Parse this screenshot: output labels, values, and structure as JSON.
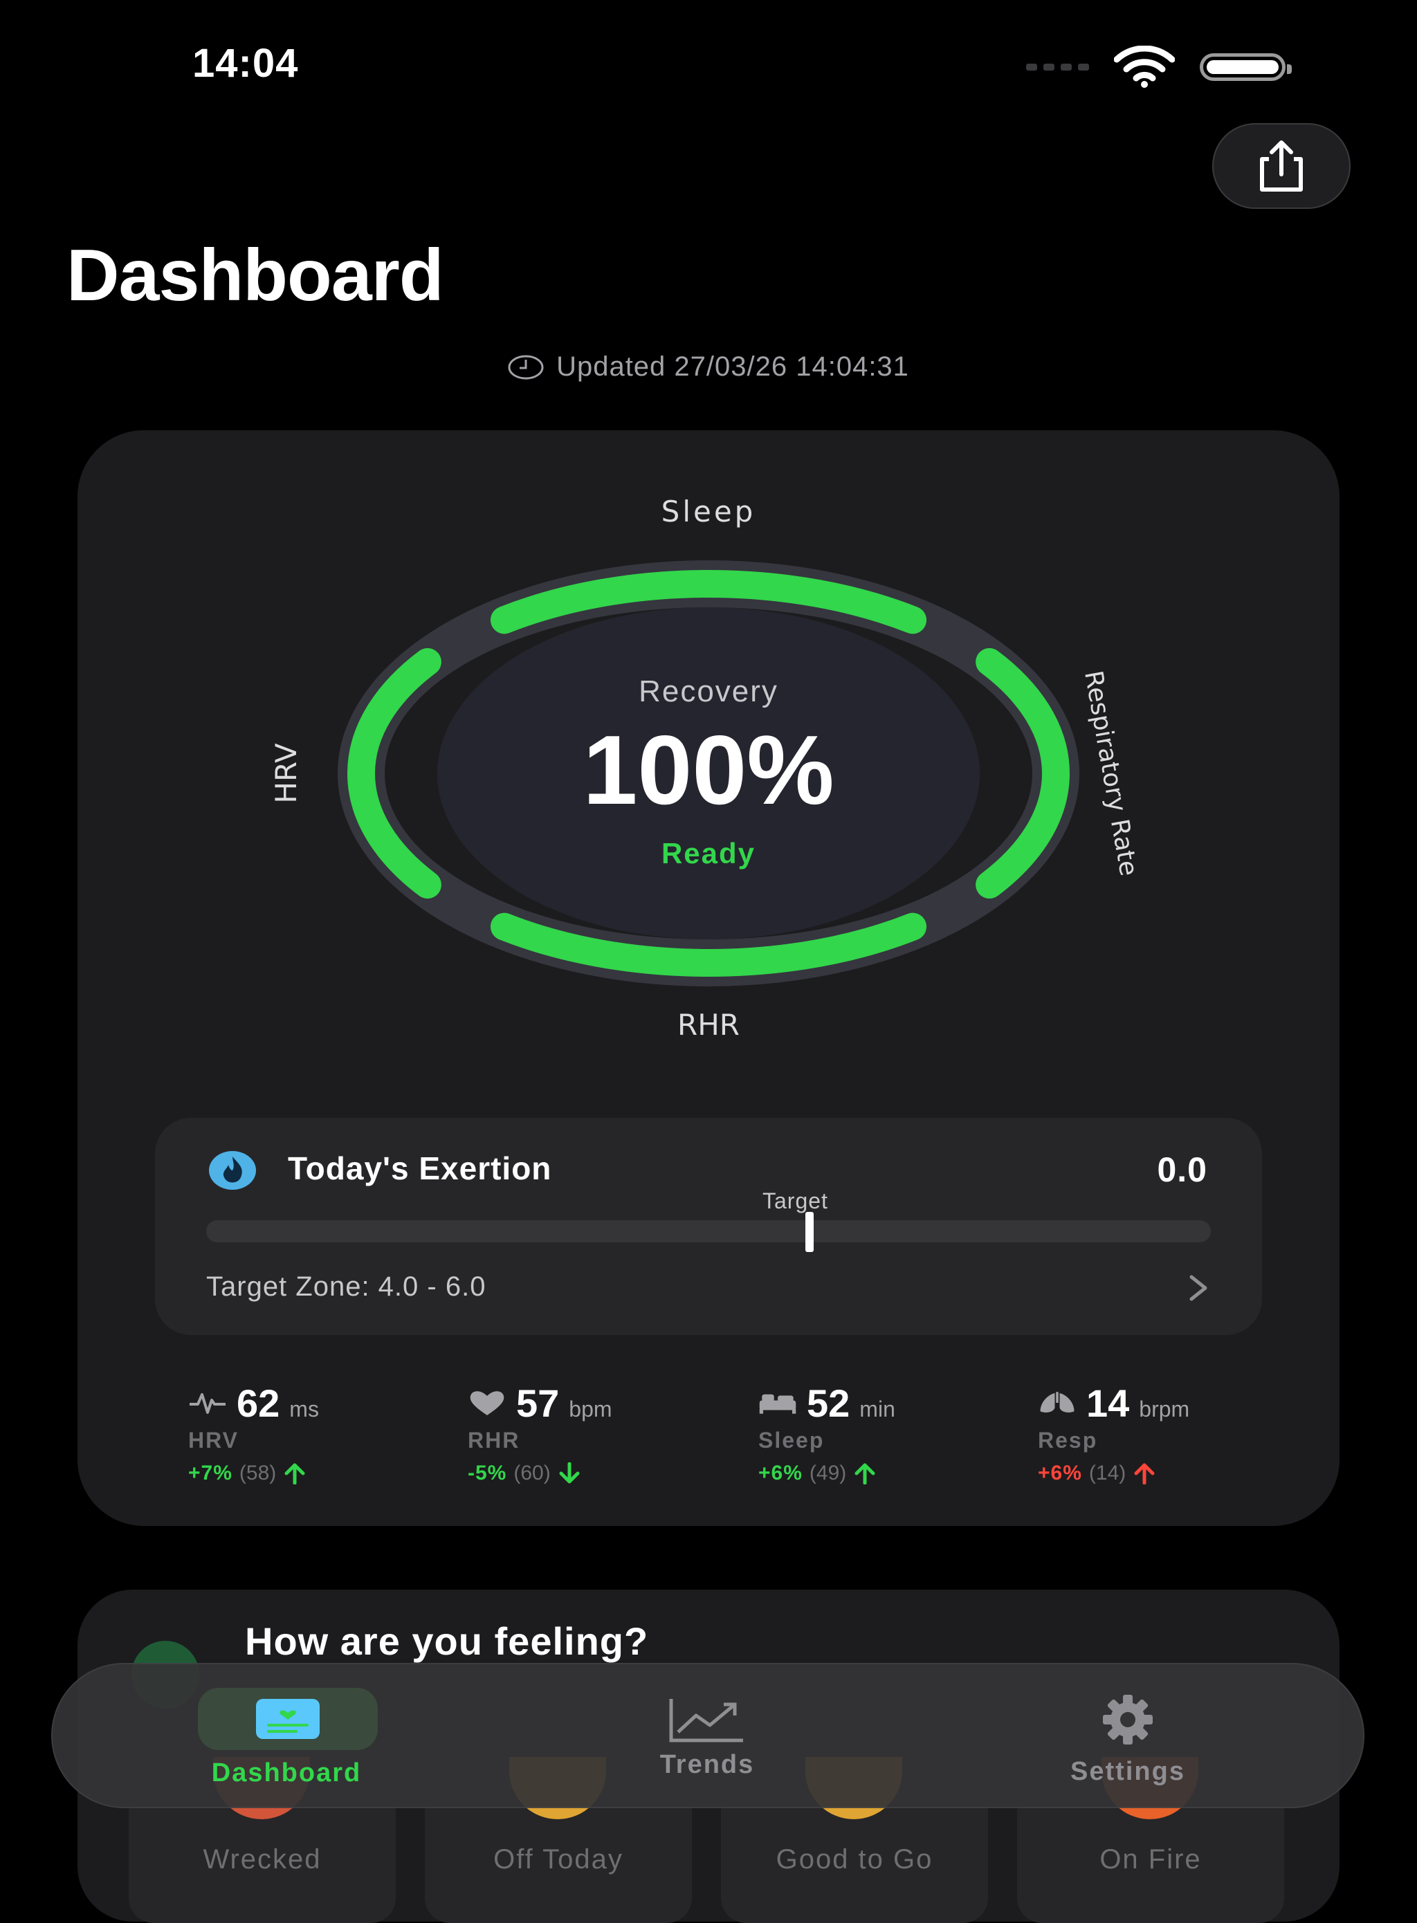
{
  "status_bar": {
    "time": "14:04",
    "icons": [
      "cellular-dots-icon",
      "wifi-icon",
      "battery-icon"
    ]
  },
  "header": {
    "share_icon": "share-icon",
    "title": "Dashboard",
    "updated_text": "Updated 27/03/26 14:04:31",
    "clock_icon": "clock-icon"
  },
  "recovery": {
    "label": "Recovery",
    "value": "100%",
    "status": "Ready",
    "status_color": "#32d74b",
    "ring_labels": {
      "top": "Sleep",
      "left": "HRV",
      "right": "Respiratory Rate",
      "bottom": "RHR"
    },
    "segments": [
      {
        "name": "Sleep",
        "fraction": 1.0
      },
      {
        "name": "Respiratory Rate",
        "fraction": 1.0
      },
      {
        "name": "RHR",
        "fraction": 1.0
      },
      {
        "name": "HRV",
        "fraction": 1.0
      }
    ],
    "ring_color": "#32d74b"
  },
  "exertion": {
    "title": "Today's Exertion",
    "value": "0.0",
    "target_label": "Target",
    "target_zone": "Target Zone: 4.0 - 6.0",
    "icon": "flame-icon"
  },
  "metrics": [
    {
      "icon": "waveform-icon",
      "value": "62",
      "unit": "ms",
      "name": "HRV",
      "delta": "+7%",
      "baseline": "(58)",
      "direction": "up",
      "color": "#32d74b"
    },
    {
      "icon": "heart-icon",
      "value": "57",
      "unit": "bpm",
      "name": "RHR",
      "delta": "-5%",
      "baseline": "(60)",
      "direction": "down",
      "color": "#32d74b"
    },
    {
      "icon": "bed-icon",
      "value": "52",
      "unit": "min",
      "name": "Sleep",
      "delta": "+6%",
      "baseline": "(49)",
      "direction": "up",
      "color": "#32d74b"
    },
    {
      "icon": "lungs-icon",
      "value": "14",
      "unit": "brpm",
      "name": "Resp",
      "delta": "+6%",
      "baseline": "(14)",
      "direction": "up",
      "color": "#ff453a"
    }
  ],
  "feeling": {
    "title": "How are you feeling?",
    "options": [
      "Wrecked",
      "Off Today",
      "Good to Go",
      "On Fire"
    ]
  },
  "tabs": [
    {
      "label": "Dashboard",
      "icon": "dashboard-icon",
      "active": true
    },
    {
      "label": "Trends",
      "icon": "trends-chart-icon",
      "active": false
    },
    {
      "label": "Settings",
      "icon": "gear-icon",
      "active": false
    }
  ]
}
